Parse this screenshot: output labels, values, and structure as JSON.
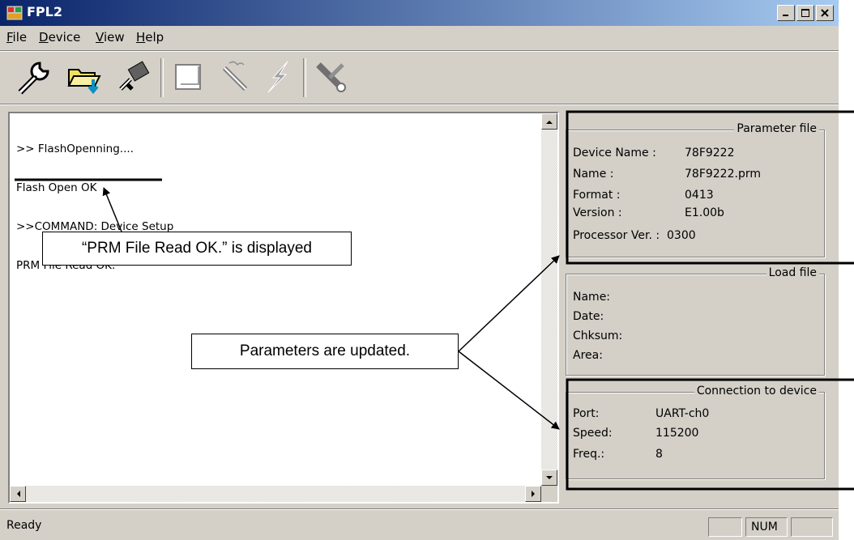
{
  "window": {
    "title": "FPL2"
  },
  "menu": [
    {
      "pre": "",
      "accel": "F",
      "post": "ile"
    },
    {
      "pre": "",
      "accel": "D",
      "post": "evice"
    },
    {
      "pre": "",
      "accel": "V",
      "post": "iew"
    },
    {
      "pre": "",
      "accel": "H",
      "post": "elp"
    }
  ],
  "toolbar": {
    "icons": [
      "wrench-icon",
      "folder-download-icon",
      "chip-setup-icon",
      "blank-page-icon",
      "erase-wand-icon",
      "lightning-program-icon",
      "verify-tools-icon"
    ]
  },
  "log": {
    "lines": [
      ">> FlashOpenning....",
      "Flash Open OK",
      ">>COMMAND: Device Setup",
      "PRM File Read OK."
    ]
  },
  "parameter_file": {
    "title": "Parameter file",
    "device_name_label": "Device Name :",
    "device_name_value": "78F9222",
    "name_label": "Name :",
    "name_value": "78F9222.prm",
    "format_label": "Format :",
    "format_value": "0413",
    "version_label": "Version :",
    "version_value": "E1.00b",
    "processor_label": "Processor Ver. :",
    "processor_value": "0300"
  },
  "load_file": {
    "title": "Load file",
    "name_label": "Name:",
    "date_label": "Date:",
    "chksum_label": "Chksum:",
    "area_label": "Area:"
  },
  "connection": {
    "title": "Connection to device",
    "port_label": "Port:",
    "port_value": "UART-ch0",
    "speed_label": "Speed:",
    "speed_value": "115200",
    "freq_label": "Freq.:",
    "freq_value": "8"
  },
  "status": {
    "text": "Ready",
    "num": "NUM"
  },
  "annotations": {
    "prm_callout": "“PRM File Read OK.” is displayed",
    "params_callout": "Parameters are updated."
  }
}
